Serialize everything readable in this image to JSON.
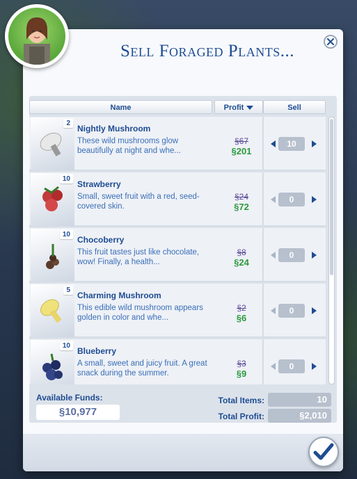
{
  "title": "Sell Foraged Plants...",
  "columns": {
    "name": "Name",
    "profit": "Profit",
    "sell": "Sell"
  },
  "items": [
    {
      "qty": "2",
      "name": "Nightly Mushroom",
      "desc": "These wild mushrooms glow beautifully at night and whe...",
      "old_price": "§67",
      "new_price": "§201",
      "sell": "10",
      "icon": "mushroom-icon",
      "color": "#e8e8e8"
    },
    {
      "qty": "10",
      "name": "Strawberry",
      "desc": "Small, sweet fruit with a red, seed-covered skin.",
      "old_price": "§24",
      "new_price": "§72",
      "sell": "0",
      "icon": "strawberry-icon",
      "color": "#c23a3a"
    },
    {
      "qty": "10",
      "name": "Chocoberry",
      "desc": "This fruit tastes just like chocolate, wow! Finally, a health...",
      "old_price": "§8",
      "new_price": "§24",
      "sell": "0",
      "icon": "chocoberry-icon",
      "color": "#5a3a2a"
    },
    {
      "qty": "5",
      "name": "Charming Mushroom",
      "desc": "This edible wild mushroom appears golden in color and whe...",
      "old_price": "§2",
      "new_price": "§6",
      "sell": "0",
      "icon": "mushroom-icon",
      "color": "#f0e27a"
    },
    {
      "qty": "10",
      "name": "Blueberry",
      "desc": "A small, sweet and juicy fruit. A great snack during the summer.",
      "old_price": "§3",
      "new_price": "§9",
      "sell": "0",
      "icon": "blueberry-icon",
      "color": "#2a3a78"
    }
  ],
  "footer": {
    "funds_label": "Available Funds:",
    "funds_value": "§10,977",
    "total_items_label": "Total Items:",
    "total_items_value": "10",
    "total_profit_label": "Total Profit:",
    "total_profit_value": "§2,010"
  }
}
